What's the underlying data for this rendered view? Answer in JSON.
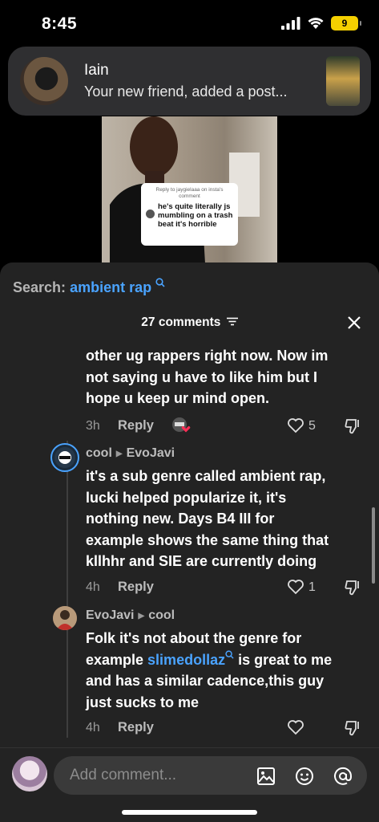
{
  "status_bar": {
    "time": "8:45",
    "battery": "9"
  },
  "notification": {
    "title": "Iain",
    "text": "Your new friend, added a post..."
  },
  "video": {
    "sticker_header": "Reply to jaygielaaa on insta's comment",
    "sticker_text": "he's quite literally js mumbling on a trash beat it's horrible"
  },
  "search": {
    "prefix": "Search:",
    "term": "ambient rap"
  },
  "comments_header": {
    "label": "27 comments"
  },
  "comments": [
    {
      "text_lines": [
        "other ug rappers right now. Now im",
        "not saying u have to like him but I",
        "hope u keep ur mind open."
      ],
      "time": "3h",
      "reply": "Reply",
      "likes": "5"
    },
    {
      "author": "cool",
      "reply_to": "EvoJavi",
      "text_lines": [
        "it's a sub genre called ambient rap,",
        "lucki helped popularize it, it's",
        "nothing new. Days B4 III for",
        "example shows the same thing that",
        "kllhhr and SIE are currently doing"
      ],
      "time": "4h",
      "reply": "Reply",
      "likes": "1"
    },
    {
      "author": "EvoJavi",
      "reply_to": "cool",
      "text_line1": "Folk it's not about the genre for",
      "text_line2_pre": "example ",
      "text_line2_mention": "slimedollaz",
      "text_line2_post": " is great to me",
      "text_line3": "and has a similar cadence,this guy",
      "text_line4": "just sucks to me",
      "time": "4h",
      "reply": "Reply"
    }
  ],
  "composer": {
    "placeholder": "Add comment..."
  }
}
